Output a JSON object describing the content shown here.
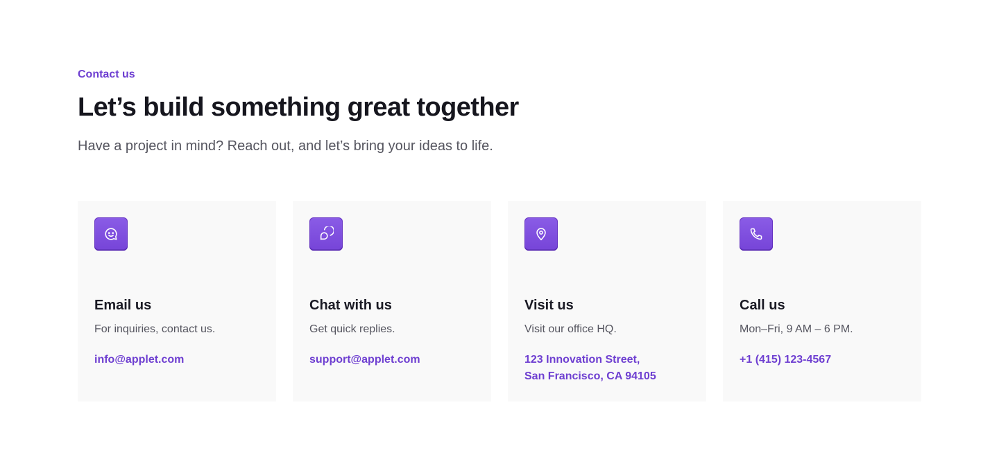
{
  "header": {
    "eyebrow": "Contact us",
    "title": "Let’s build something great together",
    "subtitle": "Have a project in mind? Reach out, and let’s bring your ideas to life."
  },
  "colors": {
    "accent": "#6E3FD1",
    "icon_bg": "#7E4ED9",
    "card_bg": "#F9F9F9",
    "heading": "#16161E",
    "muted": "#55555F"
  },
  "cards": [
    {
      "icon": "smile-message-icon",
      "title": "Email us",
      "description": "For inquiries, contact us.",
      "link": "info@applet.com"
    },
    {
      "icon": "chat-bubble-icon",
      "title": "Chat with us",
      "description": "Get quick replies.",
      "link": "support@applet.com"
    },
    {
      "icon": "map-pin-icon",
      "title": "Visit us",
      "description": "Visit our office HQ.",
      "link": "123 Innovation Street,\nSan Francisco, CA 94105"
    },
    {
      "icon": "phone-icon",
      "title": "Call us",
      "description": "Mon–Fri, 9 AM – 6 PM.",
      "link": "+1 (415) 123-4567"
    }
  ]
}
